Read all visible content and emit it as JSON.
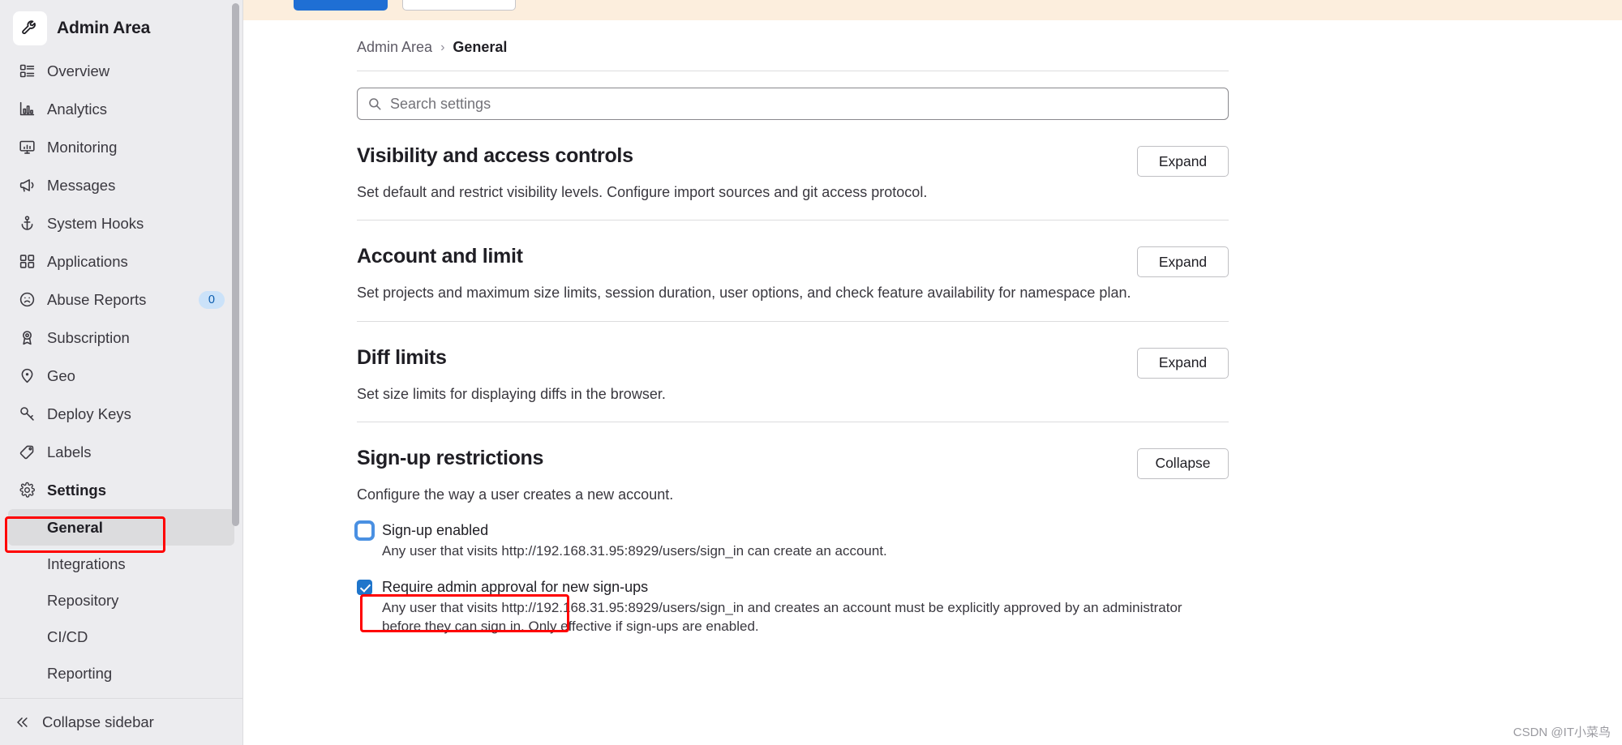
{
  "sidebar": {
    "brand": {
      "label": "Admin Area",
      "icon": "wrench-icon"
    },
    "items": [
      {
        "label": "Overview",
        "icon": "overview-icon",
        "bold": false,
        "badge": null
      },
      {
        "label": "Analytics",
        "icon": "analytics-icon",
        "bold": false,
        "badge": null
      },
      {
        "label": "Monitoring",
        "icon": "monitoring-icon",
        "bold": false,
        "badge": null
      },
      {
        "label": "Messages",
        "icon": "megaphone-icon",
        "bold": false,
        "badge": null
      },
      {
        "label": "System Hooks",
        "icon": "anchor-icon",
        "bold": false,
        "badge": null
      },
      {
        "label": "Applications",
        "icon": "applications-icon",
        "bold": false,
        "badge": null
      },
      {
        "label": "Abuse Reports",
        "icon": "frown-icon",
        "bold": false,
        "badge": "0"
      },
      {
        "label": "Subscription",
        "icon": "license-icon",
        "bold": false,
        "badge": null
      },
      {
        "label": "Geo",
        "icon": "location-icon",
        "bold": false,
        "badge": null
      },
      {
        "label": "Deploy Keys",
        "icon": "key-icon",
        "bold": false,
        "badge": null
      },
      {
        "label": "Labels",
        "icon": "label-icon",
        "bold": false,
        "badge": null
      },
      {
        "label": "Settings",
        "icon": "gear-icon",
        "bold": true,
        "badge": null
      }
    ],
    "subitems": [
      {
        "label": "General",
        "active": true
      },
      {
        "label": "Integrations",
        "active": false
      },
      {
        "label": "Repository",
        "active": false
      },
      {
        "label": "CI/CD",
        "active": false
      },
      {
        "label": "Reporting",
        "active": false
      }
    ],
    "footer": {
      "label": "Collapse sidebar",
      "icon": "chevron-double-left-icon"
    }
  },
  "breadcrumb": {
    "root": "Admin Area",
    "separator": "›",
    "current": "General"
  },
  "search": {
    "placeholder": "Search settings",
    "value": "",
    "icon": "search-icon"
  },
  "sections": [
    {
      "title": "Visibility and access controls",
      "description": "Set default and restrict visibility levels. Configure import sources and git access protocol.",
      "button": "Expand"
    },
    {
      "title": "Account and limit",
      "description": "Set projects and maximum size limits, session duration, user options, and check feature availability for namespace plan.",
      "button": "Expand"
    },
    {
      "title": "Diff limits",
      "description": "Set size limits for displaying diffs in the browser.",
      "button": "Expand"
    }
  ],
  "signup_section": {
    "title": "Sign-up restrictions",
    "description": "Configure the way a user creates a new account.",
    "button": "Collapse",
    "options": [
      {
        "label": "Sign-up enabled",
        "checked": false,
        "focused": true,
        "help": "Any user that visits http://192.168.31.95:8929/users/sign_in can create an account."
      },
      {
        "label": "Require admin approval for new sign-ups",
        "checked": true,
        "focused": false,
        "help": "Any user that visits http://192.168.31.95:8929/users/sign_in and creates an account must be explicitly approved by an administrator before they can sign in. Only effective if sign-ups are enabled."
      }
    ]
  },
  "watermark": "CSDN @IT小菜鸟",
  "colors": {
    "accent": "#1f75cb",
    "sidebar_bg": "#ececef",
    "active_bg": "#dcdcde",
    "banner_bg": "#fceedd",
    "annotation": "#ff0000",
    "badge_bg": "#cbe2f9"
  }
}
